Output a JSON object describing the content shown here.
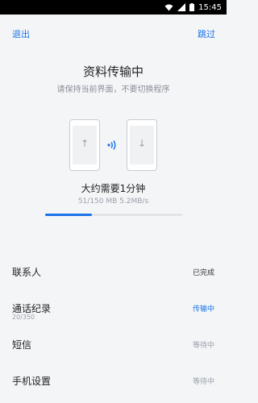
{
  "status_bar": {
    "time": "15:45"
  },
  "nav": {
    "left": "退出",
    "right": "跳过"
  },
  "header": {
    "title": "资料传输中",
    "subtitle": "请保持当前界面，不要切换程序"
  },
  "transfer": {
    "eta": "大约需要1分钟",
    "amount": "51/150 MB",
    "speed": "5.2MB/s",
    "progress": 0.34,
    "icons": [
      "phone-upload-icon",
      "signal-icon",
      "phone-download-icon"
    ]
  },
  "items": [
    {
      "name": "联系人",
      "detail": "",
      "status": "已完成",
      "status_color": "#333333"
    },
    {
      "name": "通话纪录",
      "detail": "20/350",
      "status": "传输中",
      "status_color": "#1a73e8"
    },
    {
      "name": "短信",
      "detail": "",
      "status": "等待中",
      "status_color": "#9aa0a8"
    },
    {
      "name": "手机设置",
      "detail": "",
      "status": "等待中",
      "status_color": "#9aa0a8"
    }
  ],
  "colors": {
    "accent": "#1a73e8",
    "background": "#f4f5f7"
  }
}
